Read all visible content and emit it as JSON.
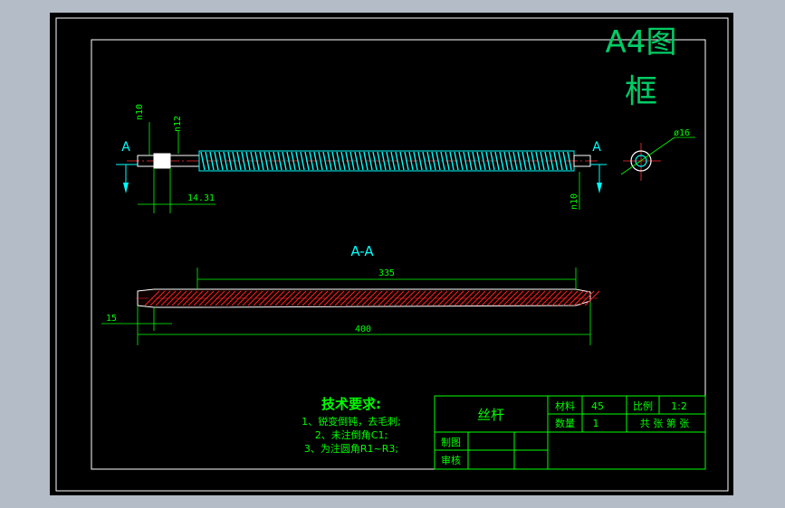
{
  "frame_title": {
    "line1": "A4图",
    "line2": "框"
  },
  "top_view": {
    "section_mark_left": "A",
    "section_mark_right": "A",
    "dim_n10_left": "n10",
    "dim_n12": "n12",
    "dim_n10_right": "n10",
    "dim_14_31": "14.31",
    "dim_phi16": "ø16"
  },
  "section_view": {
    "title": "A-A",
    "dim_335": "335",
    "dim_15": "15",
    "dim_400": "400"
  },
  "tech_requirements": {
    "heading": "技术要求:",
    "items": [
      "1、锐变倒钝，去毛刺;",
      "2、未注倒角C1;",
      "3、为注圆角R1~R3;"
    ]
  },
  "title_block": {
    "part_name": "丝杆",
    "material_label": "材料",
    "material_value": "45",
    "scale_label": "比例",
    "scale_value": "1:2",
    "quantity_label": "数量",
    "quantity_value": "1",
    "sheet_info": "共  张 第  张",
    "drawn_by_label": "制图",
    "checked_by_label": "审核"
  },
  "colors": {
    "background": "#000000",
    "frame_line": "#ffffff",
    "dimension": "#00ff00",
    "thread": "#00ffff",
    "hatch": "#ff0000",
    "title_text": "#00cc66"
  }
}
